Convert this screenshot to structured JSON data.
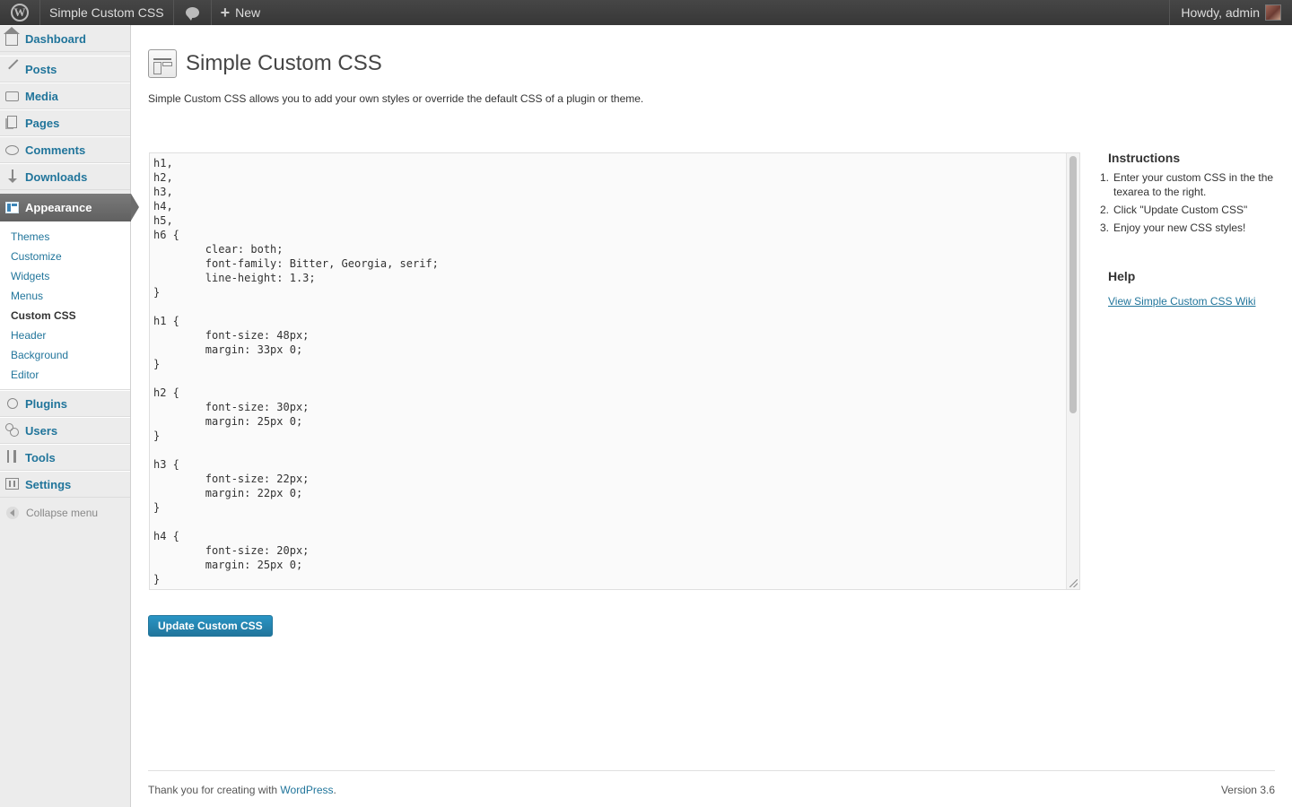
{
  "admin_bar": {
    "site_name": "Simple Custom CSS",
    "new_label": "New",
    "howdy": "Howdy, admin"
  },
  "sidebar": {
    "dashboard": "Dashboard",
    "items_top": [
      {
        "label": "Posts",
        "icon": "pin-icon"
      },
      {
        "label": "Media",
        "icon": "media-icon"
      },
      {
        "label": "Pages",
        "icon": "pages-icon"
      },
      {
        "label": "Comments",
        "icon": "comments-icon"
      },
      {
        "label": "Downloads",
        "icon": "downloads-icon"
      }
    ],
    "appearance": "Appearance",
    "appearance_submenu": [
      "Themes",
      "Customize",
      "Widgets",
      "Menus",
      "Custom CSS",
      "Header",
      "Background",
      "Editor"
    ],
    "current_submenu": "Custom CSS",
    "items_bottom": [
      {
        "label": "Plugins",
        "icon": "plugins-icon"
      },
      {
        "label": "Users",
        "icon": "users-icon"
      },
      {
        "label": "Tools",
        "icon": "tools-icon"
      },
      {
        "label": "Settings",
        "icon": "settings-icon"
      }
    ],
    "collapse": "Collapse menu"
  },
  "page": {
    "title": "Simple Custom CSS",
    "description": "Simple Custom CSS allows you to add your own styles or override the default CSS of a plugin or theme.",
    "css_content": "h1,\nh2,\nh3,\nh4,\nh5,\nh6 {\n\tclear: both;\n\tfont-family: Bitter, Georgia, serif;\n\tline-height: 1.3;\n}\n\nh1 {\n\tfont-size: 48px;\n\tmargin: 33px 0;\n}\n\nh2 {\n\tfont-size: 30px;\n\tmargin: 25px 0;\n}\n\nh3 {\n\tfont-size: 22px;\n\tmargin: 22px 0;\n}\n\nh4 {\n\tfont-size: 20px;\n\tmargin: 25px 0;\n}",
    "update_button": "Update Custom CSS"
  },
  "instructions": {
    "heading": "Instructions",
    "steps": [
      "Enter your custom CSS in the the texarea to the right.",
      "Click \"Update Custom CSS\"",
      "Enjoy your new CSS styles!"
    ],
    "help_heading": "Help",
    "help_link": "View Simple Custom CSS Wiki"
  },
  "footer": {
    "thanks_prefix": "Thank you for creating with ",
    "wordpress_link": "WordPress",
    "thanks_suffix": ".",
    "version": "Version 3.6"
  },
  "colors": {
    "link": "#21759b",
    "admin_bar": "#464646",
    "current_menu": "#6d6d6d",
    "primary_button": "#21759b"
  }
}
